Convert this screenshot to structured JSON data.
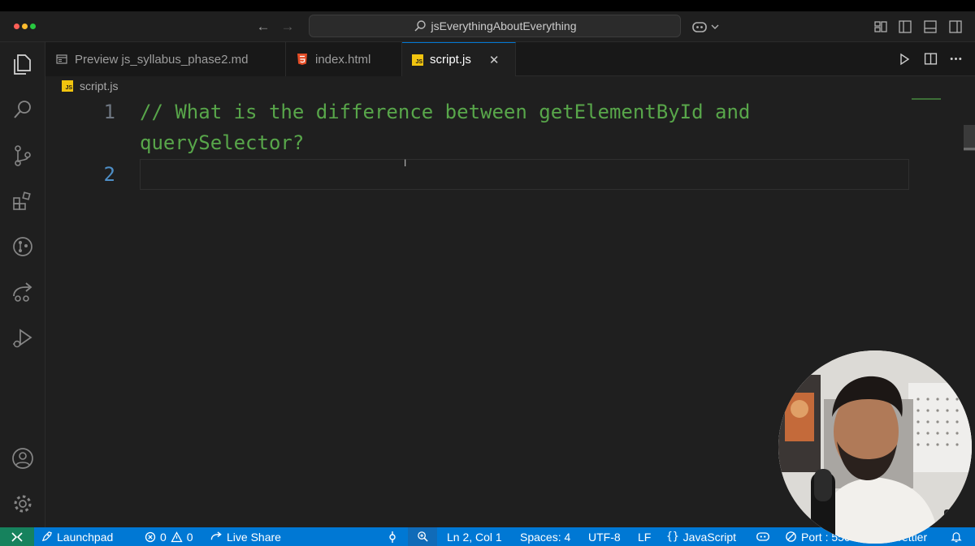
{
  "window": {
    "title": "jsEverythingAboutEverything",
    "traffic_colors": [
      "#ff5f57",
      "#febc2e",
      "#28c840"
    ]
  },
  "tabs": [
    {
      "label": "Preview js_syllabus_phase2.md",
      "icon": "preview-icon",
      "active": false
    },
    {
      "label": "index.html",
      "icon": "html5-icon",
      "active": false
    },
    {
      "label": "script.js",
      "icon": "js-file-icon",
      "active": true
    }
  ],
  "js_badge": "JS",
  "breadcrumb": {
    "file": "script.js"
  },
  "editor": {
    "lines": [
      {
        "number": "1",
        "text": "// What is the difference between getElementById and",
        "wrap": "querySelector?"
      },
      {
        "number": "2",
        "text": ""
      }
    ]
  },
  "statusbar": {
    "launchpad": "Launchpad",
    "errors": "0",
    "warnings": "0",
    "live_share": "Live Share",
    "cursor": "Ln 2, Col 1",
    "spaces": "Spaces: 4",
    "encoding": "UTF-8",
    "eol": "LF",
    "language": "JavaScript",
    "port": "Port : 550",
    "prettier": "Prettier"
  },
  "colors": {
    "accent": "#0078d4",
    "comment": "#58a64a",
    "remote": "#16825d"
  }
}
